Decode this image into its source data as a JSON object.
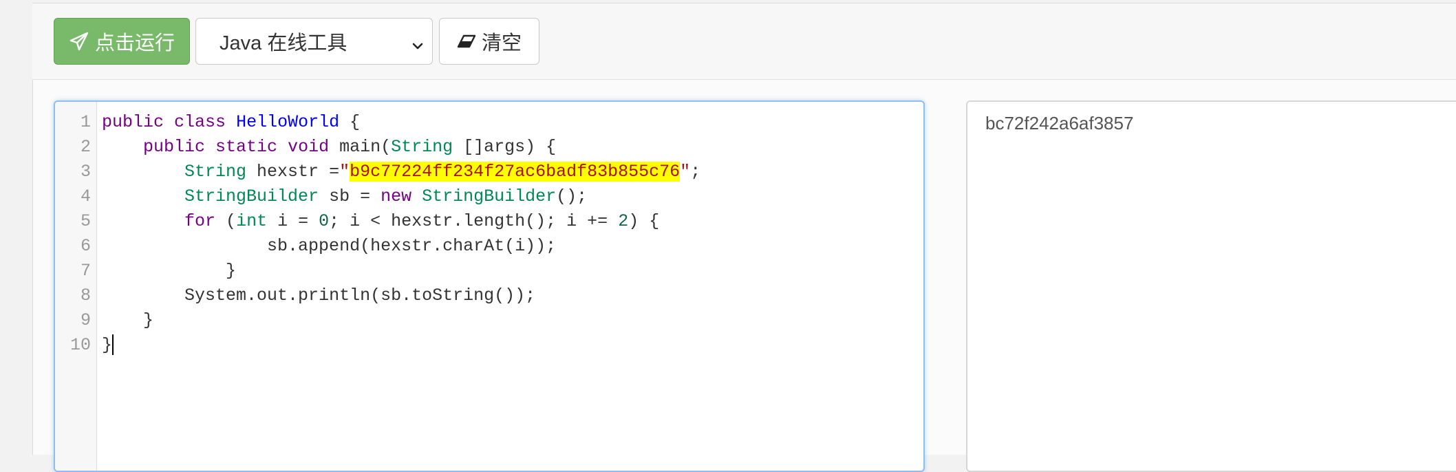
{
  "toolbar": {
    "run_label": "点击运行",
    "language_selected": "Java 在线工具",
    "clear_label": "清空"
  },
  "editor": {
    "line_numbers": [
      "1",
      "2",
      "3",
      "4",
      "5",
      "6",
      "7",
      "8",
      "9",
      "10"
    ],
    "lines": [
      {
        "kw1": "public",
        "kw2": "class",
        "name": "HelloWorld",
        "rest": " {"
      },
      {
        "indent": "    ",
        "kw1": "public",
        "kw2": "static",
        "kw3": "void",
        "method": " main(",
        "type": "String",
        "rest": " []args) {"
      },
      {
        "indent": "        ",
        "type": "String",
        "var": " hexstr =",
        "quote1": "\"",
        "string": "b9c77224ff234f27ac6badf83b855c76",
        "quote2": "\"",
        "rest": ";"
      },
      {
        "indent": "        ",
        "type": "StringBuilder",
        "var": " sb = ",
        "kw": "new",
        "type2": " StringBuilder",
        "rest": "();"
      },
      {
        "indent": "        ",
        "kw": "for",
        "p1": " (",
        "type": "int",
        "p2": " i = ",
        "n1": "0",
        "p3": "; i < hexstr.length(); i += ",
        "n2": "2",
        "rest": ") {"
      },
      {
        "indent": "                ",
        "text": "sb.append(hexstr.charAt(i));"
      },
      {
        "indent": "            ",
        "text": "}"
      },
      {
        "indent": "        ",
        "text": "System.out.println(sb.toString());"
      },
      {
        "indent": "    ",
        "text": "}"
      },
      {
        "indent": "",
        "text": "}"
      }
    ]
  },
  "output": {
    "text": "bc72f242a6af3857"
  },
  "colors": {
    "run_button": "#78b96a",
    "keyword": "#770088",
    "class_name": "#0000ff",
    "type": "#008855",
    "string": "#aa1111",
    "highlight": "#ffff00",
    "focus_border": "#8fbdf0"
  },
  "icons": {
    "run": "paper-plane-icon",
    "select": "chevron-down-icon",
    "clear": "eraser-icon"
  }
}
